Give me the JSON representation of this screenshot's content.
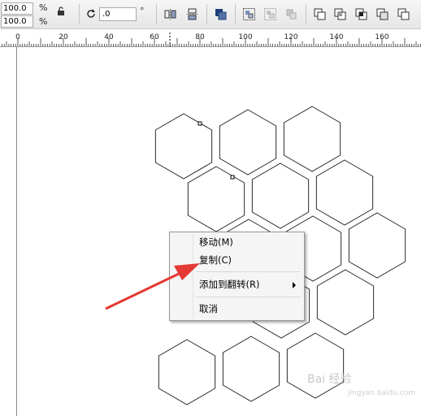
{
  "toolbar": {
    "scale_x": "100.0",
    "scale_y": "100.0",
    "percent_x": "%",
    "percent_y": "%",
    "angle_value": ".0",
    "degree_symbol": "°",
    "icons": [
      "lock-icon",
      "rotate-icon",
      "mirror-horizontal-icon",
      "mirror-vertical-icon",
      "combine-icon",
      "group-icon",
      "ungroup-icon",
      "ungroup-all-icon",
      "weld-icon",
      "trim-icon",
      "intersect-icon",
      "simplify-icon",
      "front-minus-back-icon"
    ]
  },
  "ruler": {
    "labels": [
      "0",
      "20",
      "40",
      "60",
      "80",
      "100",
      "120",
      "140",
      "160"
    ]
  },
  "context_menu": {
    "items": [
      {
        "label": "移动(M)"
      },
      {
        "label": "复制(C)"
      },
      {
        "label": "添加到翻转(R)",
        "has_submenu": true
      },
      {
        "label": "取消"
      }
    ]
  },
  "watermark": {
    "text": "Bai 经验",
    "sub": "jingyan.baidu.com"
  },
  "colors": {
    "annotation_arrow": "#e53935",
    "hex_stroke": "#2a2a2a"
  }
}
